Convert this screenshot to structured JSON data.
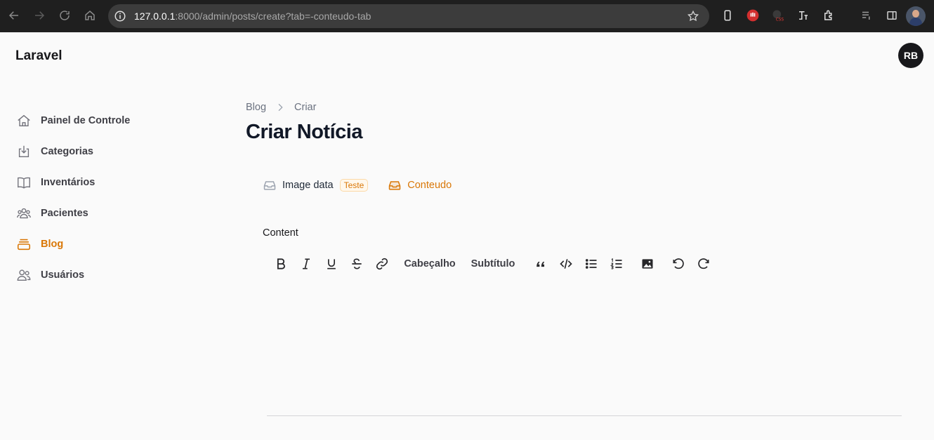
{
  "browser": {
    "url_host": "127.0.0.1",
    "url_rest": ":8000/admin/posts/create?tab=-conteudo-tab",
    "icons": [
      "back-icon",
      "forward-icon",
      "reload-icon",
      "home-icon",
      "site-info-icon",
      "bookmark-star-icon"
    ]
  },
  "app": {
    "brand": "Laravel",
    "user_initials": "RB"
  },
  "sidebar": {
    "items": [
      {
        "label": "Painel de Controle",
        "icon": "home-icon",
        "active": false
      },
      {
        "label": "Categorias",
        "icon": "download-tray-icon",
        "active": false
      },
      {
        "label": "Inventários",
        "icon": "book-open-icon",
        "active": false
      },
      {
        "label": "Pacientes",
        "icon": "user-group-icon",
        "active": false
      },
      {
        "label": "Blog",
        "icon": "stack-icon",
        "active": true
      },
      {
        "label": "Usuários",
        "icon": "users-icon",
        "active": false
      }
    ],
    "accent": "#d97706"
  },
  "breadcrumb": {
    "items": [
      "Blog",
      "Criar"
    ]
  },
  "page": {
    "title": "Criar Notícia"
  },
  "tabs": [
    {
      "label": "Image data",
      "badge": "Teste",
      "active": false,
      "icon": "inbox-icon"
    },
    {
      "label": "Conteudo",
      "active": true,
      "icon": "inbox-icon"
    }
  ],
  "editor": {
    "label": "Content",
    "toolbar": {
      "heading": "Cabeçalho",
      "subheading": "Subtítulo",
      "buttons": [
        "bold-icon",
        "italic-icon",
        "underline-icon",
        "strike-icon",
        "link-icon",
        "quote-icon",
        "code-icon",
        "bullet-list-icon",
        "ordered-list-icon",
        "image-icon",
        "undo-icon",
        "redo-icon"
      ]
    }
  }
}
